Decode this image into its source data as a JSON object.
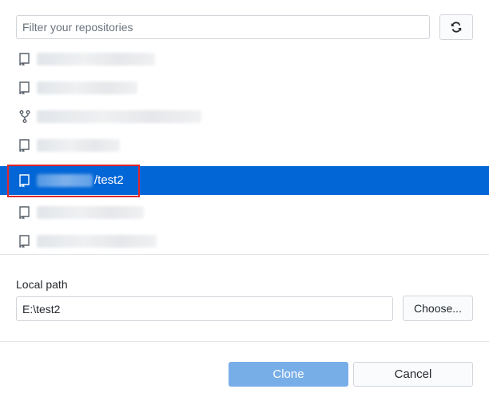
{
  "filter": {
    "placeholder": "Filter your repositories",
    "value": ""
  },
  "refresh_icon": "sync-icon",
  "repositories": [
    {
      "icon": "repo-icon",
      "name_visible": false
    },
    {
      "icon": "repo-icon",
      "name_visible": false
    },
    {
      "icon": "fork-icon",
      "name_visible": false
    },
    {
      "icon": "repo-icon",
      "name_visible": false
    },
    {
      "icon": "repo-icon",
      "name_visible": false,
      "selected": true,
      "suffix": "/test2"
    },
    {
      "icon": "repo-icon",
      "name_visible": false
    },
    {
      "icon": "repo-icon",
      "name_visible": false
    }
  ],
  "local_path": {
    "label": "Local path",
    "value": "E:\\test2",
    "choose_label": "Choose..."
  },
  "actions": {
    "clone_label": "Clone",
    "cancel_label": "Cancel"
  },
  "colors": {
    "selection": "#0366d6",
    "highlight_border": "#e0262b",
    "clone_button": "#78aee8"
  }
}
